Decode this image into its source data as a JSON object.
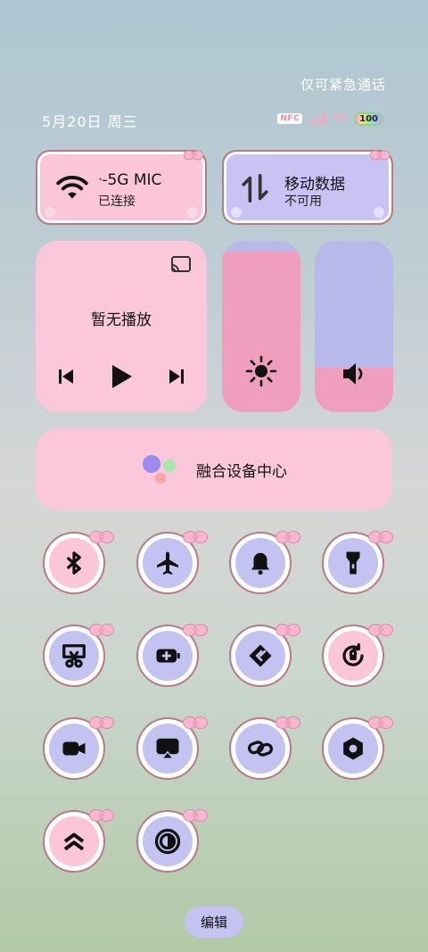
{
  "status": {
    "emergency": "仅可紧急通话",
    "date": "5月20日 周三",
    "nfc": "NFC",
    "battery": "100"
  },
  "wifi": {
    "title": "ᐧ-5G   MIC",
    "subtitle": "已连接"
  },
  "mobile_data": {
    "title": "移动数据",
    "subtitle": "不可用"
  },
  "media": {
    "status": "暂无播放"
  },
  "sliders": {
    "brightness_level": 0.94,
    "volume_level": 0.26
  },
  "device_center": {
    "label": "融合设备中心"
  },
  "tiles": [
    {
      "name": "bluetooth",
      "state": "off"
    },
    {
      "name": "airplane-mode",
      "state": "on"
    },
    {
      "name": "ringer",
      "state": "on"
    },
    {
      "name": "flashlight",
      "state": "on"
    },
    {
      "name": "screenshot",
      "state": "on"
    },
    {
      "name": "battery-saver",
      "state": "on"
    },
    {
      "name": "nearby-share",
      "state": "on"
    },
    {
      "name": "auto-rotate",
      "state": "off"
    },
    {
      "name": "screen-record",
      "state": "on"
    },
    {
      "name": "screen-cast",
      "state": "on"
    },
    {
      "name": "link",
      "state": "on"
    },
    {
      "name": "settings",
      "state": "on"
    },
    {
      "name": "performance-mode",
      "state": "off"
    },
    {
      "name": "dark-mode",
      "state": "on"
    }
  ],
  "edit": {
    "label": "编辑"
  },
  "colors": {
    "pink": "#fbc7d8",
    "lavender": "#c3c2f1",
    "accent_pink": "#f09ebd"
  }
}
